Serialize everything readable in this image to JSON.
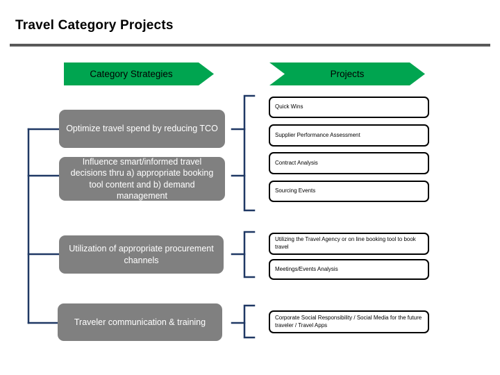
{
  "slide": {
    "title": "Travel Category Projects",
    "accent_green": "#00A550",
    "rule_color": "#595959",
    "strategy_fill": "#808080",
    "connector_color": "#1F3864"
  },
  "banners": {
    "category_strategies": "Category Strategies",
    "projects": "Projects"
  },
  "strategies": [
    {
      "id": "optimize-tco",
      "label": "Optimize travel spend by reducing TCO"
    },
    {
      "id": "influence-decisions",
      "label": "Influence smart/informed travel decisions thru a) appropriate booking tool content and b) demand management"
    },
    {
      "id": "procurement",
      "label": "Utilization of appropriate procurement channels"
    },
    {
      "id": "communication",
      "label": "Traveler communication & training"
    }
  ],
  "projects": [
    {
      "id": "quick-wins",
      "label": "Quick Wins"
    },
    {
      "id": "supplier-performance",
      "label": "Supplier Performance Assessment"
    },
    {
      "id": "contract-analysis",
      "label": "Contract Analysis"
    },
    {
      "id": "sourcing-events",
      "label": "Sourcing Events"
    },
    {
      "id": "travel-agency-booking",
      "label": "Utilizing the Travel Agency or on line booking tool to book travel"
    },
    {
      "id": "meetings-events",
      "label": "Meetings/Events Analysis"
    },
    {
      "id": "csr-social-media",
      "label": "Corporate Social Responsibility / Social Media for the future traveler / Travel Apps"
    }
  ]
}
